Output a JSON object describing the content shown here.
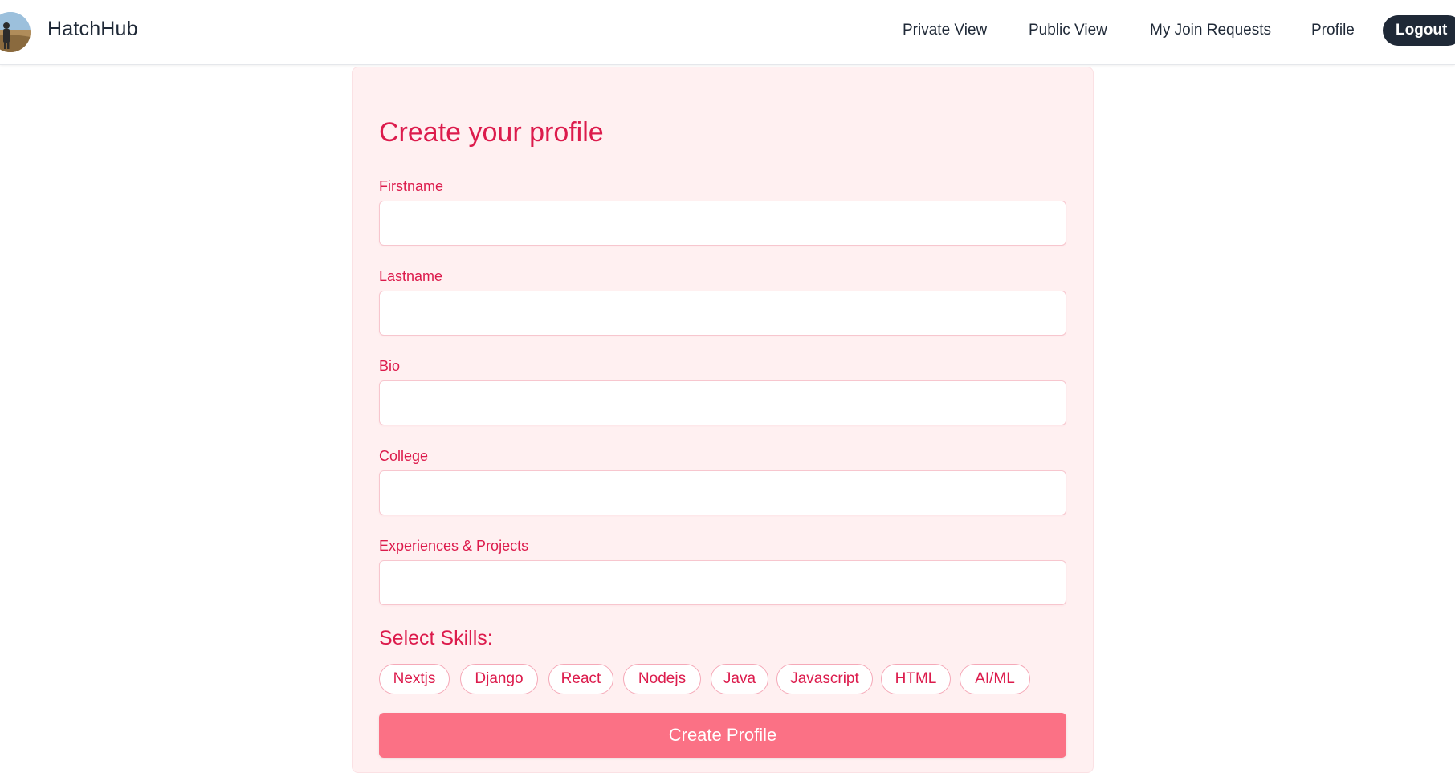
{
  "app": {
    "brand": "HatchHub",
    "avatar_icon": "user-avatar-photo"
  },
  "nav": {
    "items": [
      {
        "label": "Private View"
      },
      {
        "label": "Public View"
      },
      {
        "label": "My Join Requests"
      },
      {
        "label": "Profile"
      }
    ],
    "logout_label": "Logout"
  },
  "form": {
    "title": "Create your profile",
    "fields": [
      {
        "label": "Firstname",
        "value": ""
      },
      {
        "label": "Lastname",
        "value": ""
      },
      {
        "label": "Bio",
        "value": ""
      },
      {
        "label": "College",
        "value": ""
      },
      {
        "label": "Experiences & Projects",
        "value": ""
      }
    ],
    "skills_title": "Select Skills:",
    "skills": [
      "Nextjs",
      "Django",
      "React",
      "Nodejs",
      "Java",
      "Javascript",
      "HTML",
      "AI/ML"
    ],
    "submit_label": "Create Profile"
  },
  "colors": {
    "accent": "#dc1b4c",
    "card_bg": "#fff0f1",
    "button_bg": "#fb7185",
    "nav_dark": "#1f2937"
  }
}
